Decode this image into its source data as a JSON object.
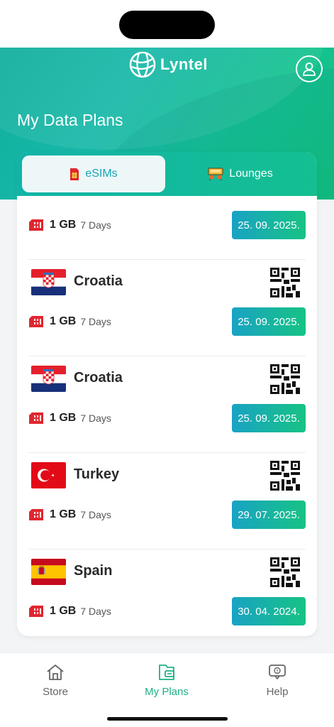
{
  "app": {
    "name": "Lyntel"
  },
  "page": {
    "title": "My Data Plans"
  },
  "tabs": [
    {
      "label": "eSIMs",
      "active": true
    },
    {
      "label": "Lounges",
      "active": false
    }
  ],
  "plans": [
    {
      "country": "",
      "flag": "none",
      "data": "1 GB",
      "duration": "7 Days",
      "date": "25. 09. 2025."
    },
    {
      "country": "Croatia",
      "flag": "croatia",
      "data": "1 GB",
      "duration": "7 Days",
      "date": "25. 09. 2025."
    },
    {
      "country": "Croatia",
      "flag": "croatia",
      "data": "1 GB",
      "duration": "7 Days",
      "date": "25. 09. 2025."
    },
    {
      "country": "Turkey",
      "flag": "turkey",
      "data": "1 GB",
      "duration": "7 Days",
      "date": "29. 07. 2025."
    },
    {
      "country": "Spain",
      "flag": "spain",
      "data": "1 GB",
      "duration": "7 Days",
      "date": "30. 04. 2024."
    }
  ],
  "nav": {
    "store": "Store",
    "plans": "My Plans",
    "help": "Help",
    "active": "plans"
  },
  "colors": {
    "accent_teal": "#15a6b6",
    "accent_green": "#1eb286",
    "sim_red": "#e0262f"
  },
  "icons": {
    "logo": "globe-icon",
    "profile": "user-icon",
    "esim_tab": "sim-card-icon",
    "lounges_tab": "lounge-icon",
    "plan_data": "sim-card-icon",
    "plan_qr": "qr-code-icon",
    "nav_store": "home-icon",
    "nav_plans": "wallet-icon",
    "nav_help": "help-chat-icon"
  }
}
